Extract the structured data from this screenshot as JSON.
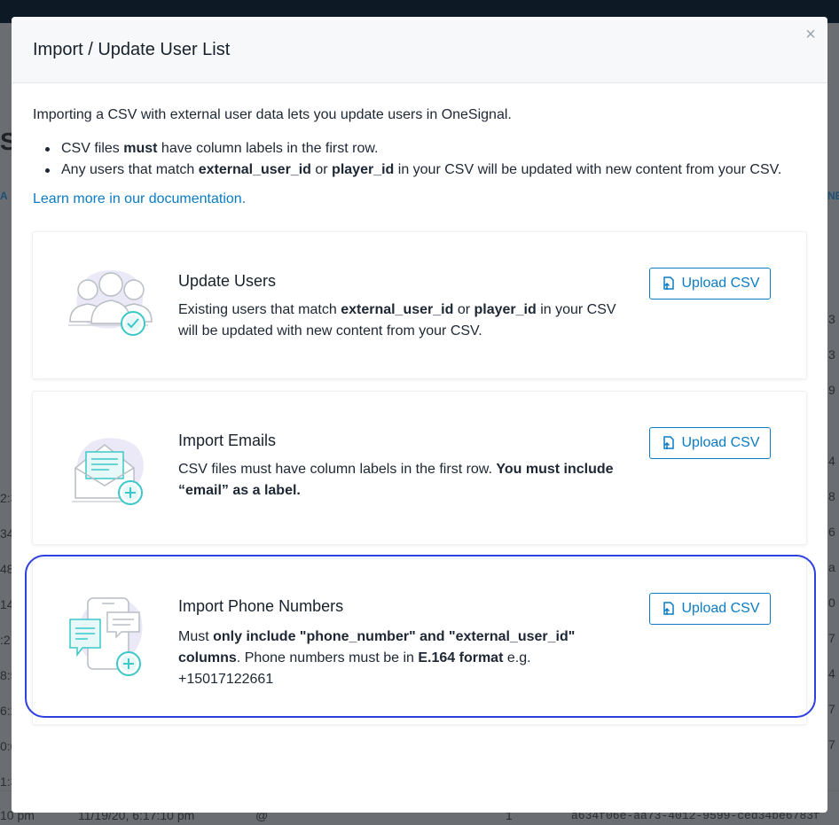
{
  "background": {
    "left_frags": [
      "S",
      "A",
      "2:3",
      "34",
      "48",
      "14",
      ":2",
      "8:5",
      "6:2",
      "0:0",
      "1:3",
      "10 pm"
    ],
    "right_frags": [
      "NE",
      "3",
      "3",
      "9",
      "4",
      "8",
      "6",
      "a",
      "0",
      "7",
      "4",
      "7",
      "7"
    ],
    "bottom_row": {
      "date": "11/19/20, 6:17:10 pm",
      "at": "@",
      "count": "1",
      "id": "a634f06e-aa73-4012-9599-ced34be6783f"
    }
  },
  "modal": {
    "title": "Import / Update User List",
    "close_glyph": "×",
    "intro": "Importing a CSV with external user data lets you update users in OneSignal.",
    "bullets": [
      {
        "pre": "CSV files ",
        "bold": "must",
        "post": " have column labels in the first row."
      },
      {
        "pre": "Any users that match ",
        "bold1": "external_user_id",
        "mid": " or ",
        "bold2": "player_id",
        "post": " in your CSV will be updated with new content from your CSV."
      }
    ],
    "doc_link": "Learn more in our documentation.",
    "cards": [
      {
        "title": "Update Users",
        "desc_pre": "Existing users that match ",
        "desc_b1": "external_user_id",
        "desc_mid": " or ",
        "desc_b2": "player_id",
        "desc_post": " in your CSV will be updated with new content from your CSV.",
        "button": "Upload CSV",
        "icon": "users-check-icon"
      },
      {
        "title": "Import Emails",
        "desc_pre": "CSV files must have column labels in the first row. ",
        "desc_b1": "You must include “email” as a label.",
        "button": "Upload CSV",
        "icon": "email-add-icon"
      },
      {
        "title": "Import Phone Numbers",
        "desc_pre": "Must ",
        "desc_b1": "only include \"phone_number\" and \"external_user_id\" columns",
        "desc_mid": ". Phone numbers must be in ",
        "desc_b2": "E.164 format",
        "desc_post": " e.g. +15017122661",
        "button": "Upload CSV",
        "icon": "phone-sms-add-icon"
      }
    ]
  },
  "colors": {
    "accent": "#0a7cc4",
    "teal": "#3cc8c8",
    "highlight": "#2f40e0"
  }
}
